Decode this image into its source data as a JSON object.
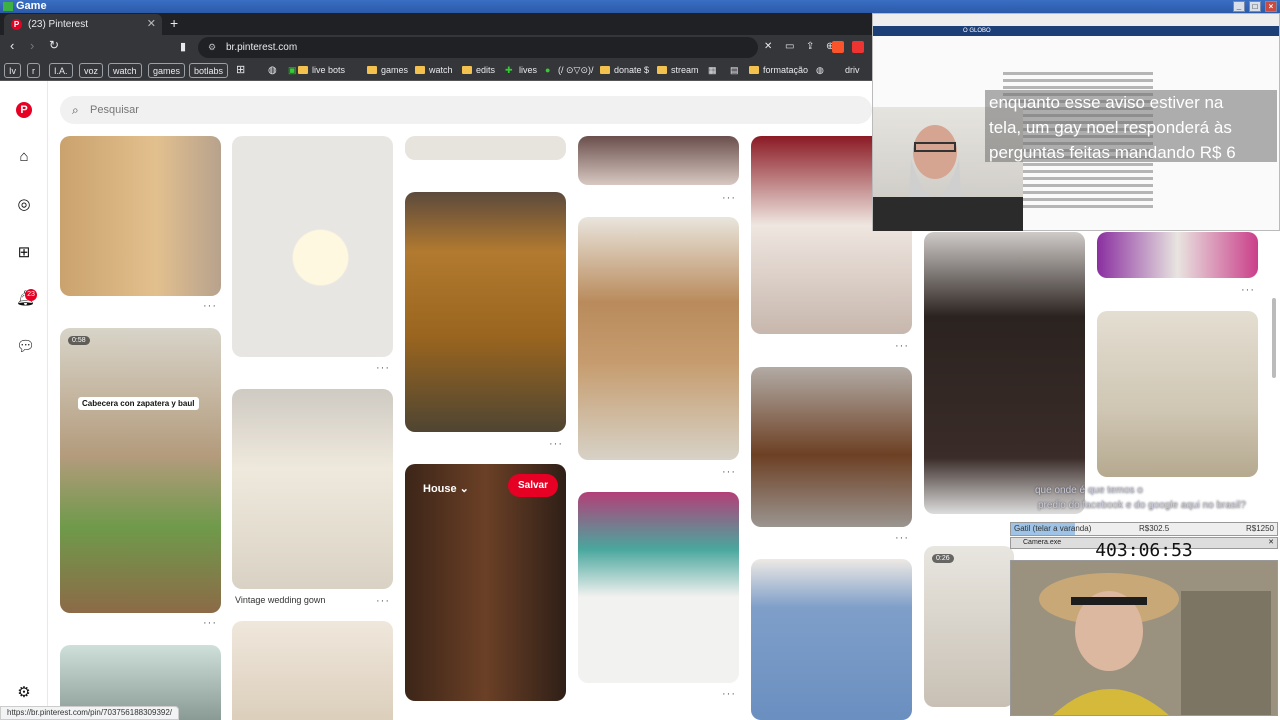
{
  "os": {
    "title": "Game"
  },
  "tab": {
    "title": "(23) Pinterest"
  },
  "url": "br.pinterest.com",
  "bookmarks": [
    "Iv",
    "r",
    "I.A.",
    "voz",
    "watch",
    "games",
    "botlabs",
    "live bots",
    "games",
    "watch",
    "edits",
    "lives",
    "(/ ⊙▽⊙)/",
    "donate $",
    "stream",
    "formatação",
    "driv"
  ],
  "search": {
    "placeholder": "Pesquisar"
  },
  "notifications": {
    "count": "23"
  },
  "pins": {
    "video1": {
      "duration": "0:58",
      "label": "Cabecera con zapatera y baul"
    },
    "wedding": {
      "caption": "Vintage wedding gown"
    },
    "house": {
      "board": "House",
      "save": "Salvar"
    },
    "video2": {
      "duration": "0:26"
    }
  },
  "overlay": {
    "site_header": "O GLOBO",
    "notice_lines": [
      "enquanto esse aviso estiver na",
      "tela, um gay noel responderá às",
      "perguntas feitas mandando R$ 6"
    ],
    "chat1": "que onde é que temos o",
    "chat2": "predio do facebook e do google aqui no brasil?",
    "goal_label": "Gatil (telar a varanda)",
    "goal_current": "R$302.5",
    "goal_target": "R$1250",
    "goal_progress": 0.24,
    "cam_title": "Camera.exe",
    "timer": "403:06:53"
  },
  "status": {
    "link": "https://br.pinterest.com/pin/703756188309392/"
  }
}
